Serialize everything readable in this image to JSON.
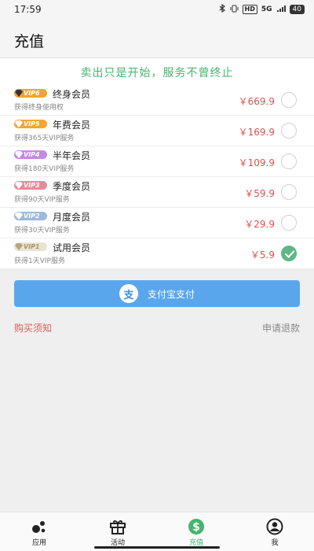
{
  "status": {
    "time": "17:59",
    "net_label": "HD",
    "signal_label": "5G",
    "battery": "40"
  },
  "header": {
    "title": "充值"
  },
  "slogan": "卖出只是开始，服务不曾终止",
  "plans": [
    {
      "badge": "VIP6",
      "badge_color": "#e9a92a",
      "gem_color": "#333333",
      "name": "终身会员",
      "desc": "获得终身使用权",
      "price": "￥669.9",
      "selected": false
    },
    {
      "badge": "VIP5",
      "badge_color": "#f3a537",
      "gem_color": "#ffffff",
      "name": "年费会员",
      "desc": "获得365天VIP服务",
      "price": "￥169.9",
      "selected": false
    },
    {
      "badge": "VIP4",
      "badge_color": "#c688e6",
      "gem_color": "#ffffff",
      "name": "半年会员",
      "desc": "获得180天VIP服务",
      "price": "￥109.9",
      "selected": false
    },
    {
      "badge": "VIP3",
      "badge_color": "#e98a9a",
      "gem_color": "#ffffff",
      "name": "季度会员",
      "desc": "获得90天VIP服务",
      "price": "￥59.9",
      "selected": false
    },
    {
      "badge": "VIP2",
      "badge_color": "#9db9de",
      "gem_color": "#ffffff",
      "name": "月度会员",
      "desc": "获得30天VIP服务",
      "price": "￥29.9",
      "selected": false
    },
    {
      "badge": "VIP1",
      "badge_color": "#e9e3d2",
      "gem_color": "#b9a77a",
      "name": "试用会员",
      "desc": "获得1天VIP服务",
      "price": "￥5.9",
      "selected": true
    }
  ],
  "pay_button": {
    "icon_glyph": "支",
    "label": "支付宝支付"
  },
  "links": {
    "notice": "购买须知",
    "refund": "申请退款"
  },
  "tabs": [
    {
      "label": "应用",
      "icon": "apps-icon",
      "active": false
    },
    {
      "label": "活动",
      "icon": "gift-icon",
      "active": false
    },
    {
      "label": "充值",
      "icon": "dollar-icon",
      "active": true
    },
    {
      "label": "我",
      "icon": "user-icon",
      "active": false
    }
  ],
  "colors": {
    "accent": "#46b46e",
    "price": "#d9534f",
    "pay_button": "#5aa6ec"
  }
}
